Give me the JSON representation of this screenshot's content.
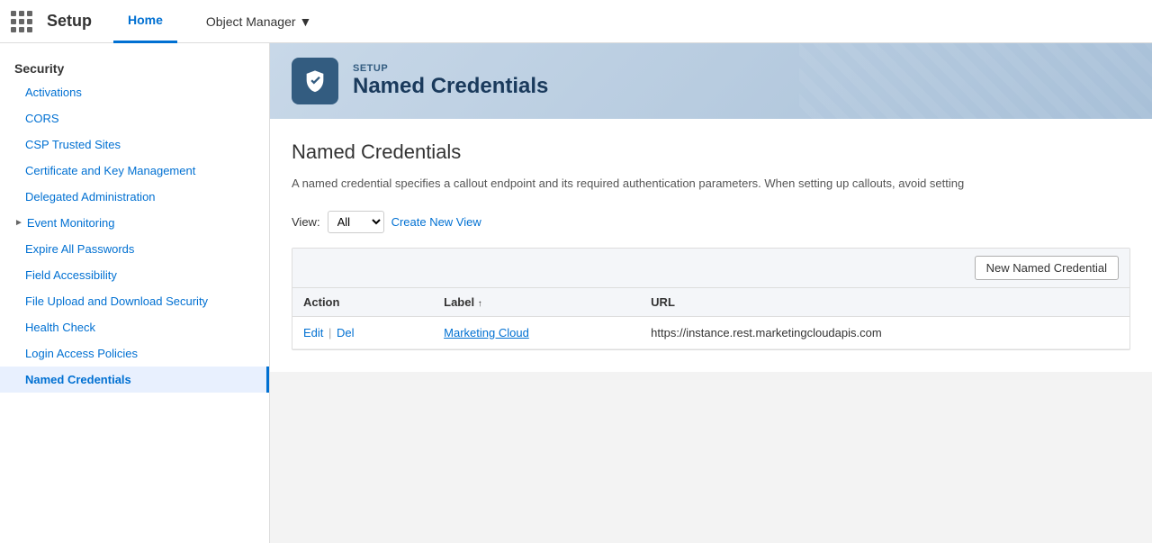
{
  "topnav": {
    "app_name": "Setup",
    "tabs": [
      {
        "id": "home",
        "label": "Home",
        "active": true
      },
      {
        "id": "object-manager",
        "label": "Object Manager",
        "active": false,
        "has_arrow": true
      }
    ]
  },
  "sidebar": {
    "section_label": "Security",
    "items": [
      {
        "id": "activations",
        "label": "Activations",
        "active": false,
        "has_arrow": false
      },
      {
        "id": "cors",
        "label": "CORS",
        "active": false,
        "has_arrow": false
      },
      {
        "id": "csp-trusted-sites",
        "label": "CSP Trusted Sites",
        "active": false,
        "has_arrow": false
      },
      {
        "id": "certificate-key",
        "label": "Certificate and Key Management",
        "active": false,
        "has_arrow": false
      },
      {
        "id": "delegated-admin",
        "label": "Delegated Administration",
        "active": false,
        "has_arrow": false
      },
      {
        "id": "event-monitoring",
        "label": "Event Monitoring",
        "active": false,
        "has_arrow": true
      },
      {
        "id": "expire-passwords",
        "label": "Expire All Passwords",
        "active": false,
        "has_arrow": false
      },
      {
        "id": "field-accessibility",
        "label": "Field Accessibility",
        "active": false,
        "has_arrow": false
      },
      {
        "id": "file-upload",
        "label": "File Upload and Download Security",
        "active": false,
        "has_arrow": false
      },
      {
        "id": "health-check",
        "label": "Health Check",
        "active": false,
        "has_arrow": false
      },
      {
        "id": "login-access",
        "label": "Login Access Policies",
        "active": false,
        "has_arrow": false
      },
      {
        "id": "named-credentials",
        "label": "Named Credentials",
        "active": true,
        "has_arrow": false
      }
    ]
  },
  "page_header": {
    "setup_label": "SETUP",
    "title": "Named Credentials",
    "icon_label": "shield-icon"
  },
  "content": {
    "title": "Named Credentials",
    "description": "A named credential specifies a callout endpoint and its required authentication parameters. When setting up callouts, avoid setting",
    "view_bar": {
      "label": "View:",
      "options": [
        "All"
      ],
      "selected": "All",
      "create_link": "Create New View"
    },
    "toolbar": {
      "new_button_label": "New Named Credential"
    },
    "table": {
      "columns": [
        {
          "id": "action",
          "label": "Action"
        },
        {
          "id": "label",
          "label": "Label",
          "sortable": true,
          "sort_arrow": "↑"
        },
        {
          "id": "url",
          "label": "URL"
        }
      ],
      "rows": [
        {
          "actions": [
            {
              "id": "edit",
              "label": "Edit"
            },
            {
              "id": "del",
              "label": "Del"
            }
          ],
          "label": "Marketing Cloud",
          "url": "https://instance.rest.marketingcloudapis.com"
        }
      ]
    }
  }
}
